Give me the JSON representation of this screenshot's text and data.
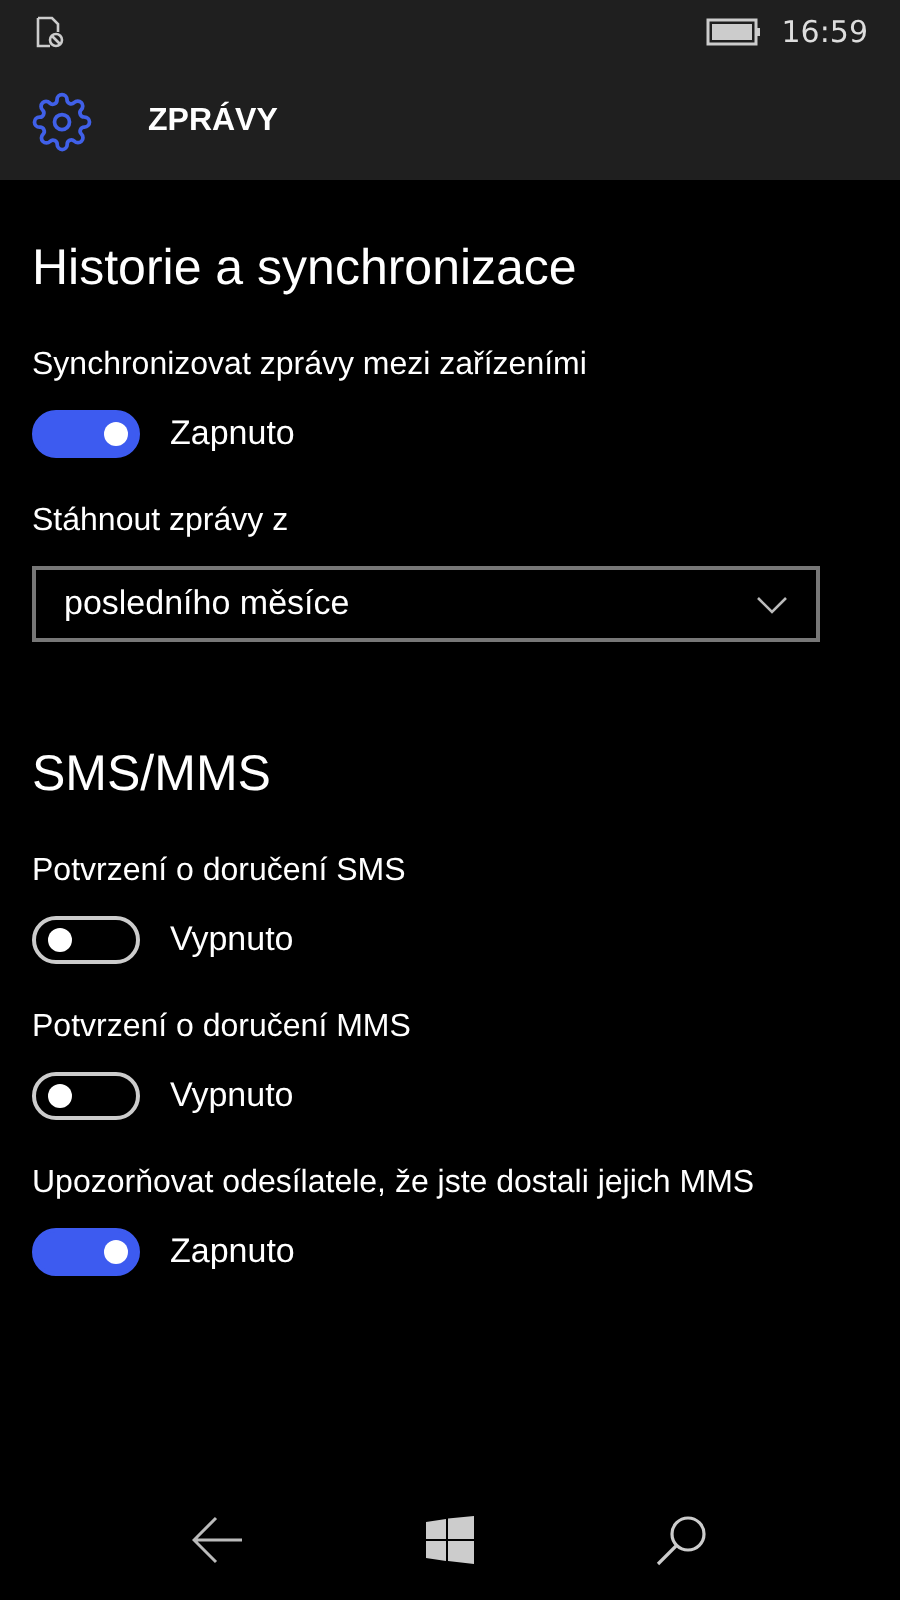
{
  "status_bar": {
    "time": "16:59"
  },
  "header": {
    "title": "ZPRÁVY"
  },
  "sections": [
    {
      "title": "Historie a synchronizace",
      "items": [
        {
          "kind": "toggle",
          "label": "Synchronizovat zprávy mezi zařízeními",
          "on": true,
          "state_text": "Zapnuto"
        },
        {
          "kind": "dropdown",
          "label": "Stáhnout zprávy z",
          "value": "posledního měsíce"
        }
      ]
    },
    {
      "title": "SMS/MMS",
      "items": [
        {
          "kind": "toggle",
          "label": "Potvrzení o doručení SMS",
          "on": false,
          "state_text": "Vypnuto"
        },
        {
          "kind": "toggle",
          "label": "Potvrzení o doručení MMS",
          "on": false,
          "state_text": "Vypnuto"
        },
        {
          "kind": "toggle",
          "label": "Upozorňovat odesílatele, že jste dostali jejich MMS",
          "on": true,
          "state_text": "Zapnuto"
        }
      ]
    }
  ]
}
